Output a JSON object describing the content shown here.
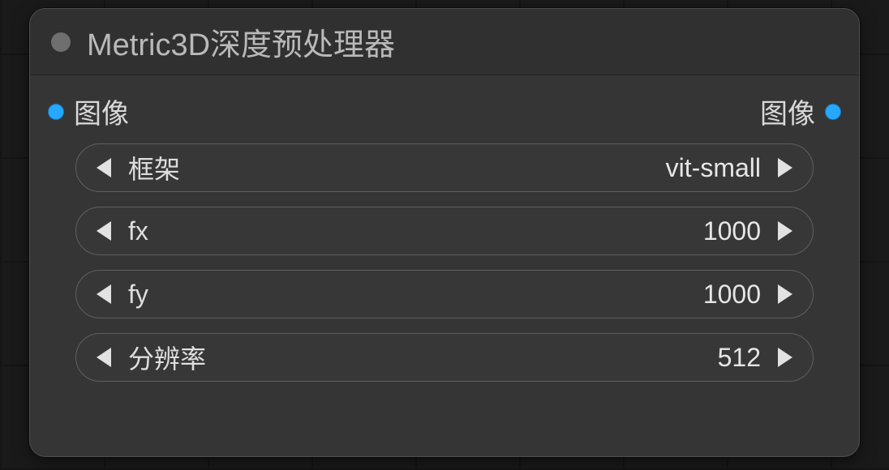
{
  "node": {
    "title": "Metric3D深度预处理器",
    "input": {
      "label": "图像"
    },
    "output": {
      "label": "图像"
    }
  },
  "params": [
    {
      "label": "框架",
      "value": "vit-small"
    },
    {
      "label": "fx",
      "value": "1000"
    },
    {
      "label": "fy",
      "value": "1000"
    },
    {
      "label": "分辨率",
      "value": "512"
    }
  ],
  "colors": {
    "port": "#27a8ff"
  }
}
